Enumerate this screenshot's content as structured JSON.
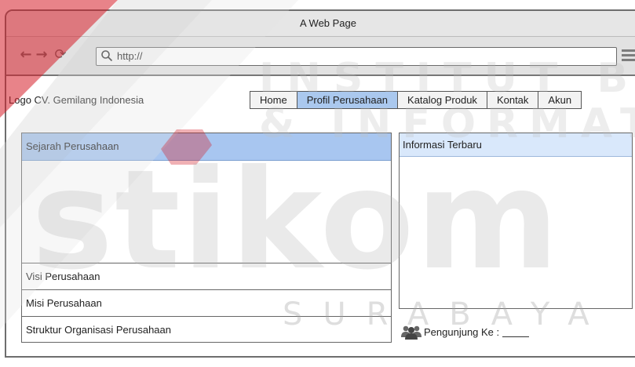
{
  "window": {
    "title": "A Web Page"
  },
  "toolbar": {
    "url": "http://"
  },
  "header": {
    "logo": "Logo CV. Gemilang Indonesia"
  },
  "nav": {
    "items": [
      {
        "label": "Home",
        "active": false
      },
      {
        "label": "Profil Perusahaan",
        "active": true
      },
      {
        "label": "Katalog Produk",
        "active": false
      },
      {
        "label": "Kontak",
        "active": false
      },
      {
        "label": "Akun",
        "active": false
      }
    ]
  },
  "left_panel": {
    "header": "Sejarah Perusahaan",
    "rows": [
      "Visi Perusahaan",
      "Misi Perusahaan",
      "Struktur Organisasi Perusahaan"
    ]
  },
  "right_panel": {
    "header": "Informasi Terbaru"
  },
  "visitor": {
    "label": "Pengunjung Ke :"
  },
  "watermark": {
    "line1": "INSTITUT BISNIS",
    "line2": "& INFORMATIKA",
    "brand": "stikom",
    "city": "SURABAYA"
  },
  "colors": {
    "active_tab": "#aac8ee",
    "section_header": "#a8c6f0",
    "info_header": "#d9e8fb",
    "watermark_red": "#d9232d"
  }
}
